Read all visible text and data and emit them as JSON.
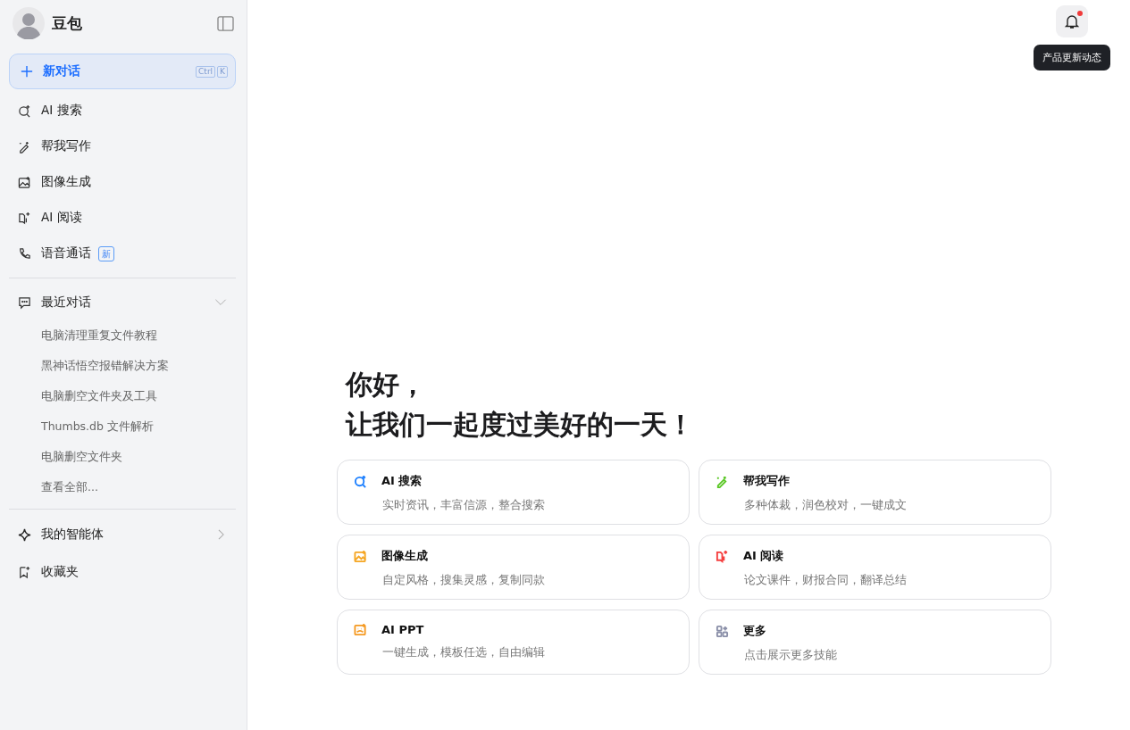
{
  "app": {
    "name": "豆包"
  },
  "new_chat": {
    "label": "新对话",
    "keys": [
      "Ctrl",
      "K"
    ]
  },
  "nav": [
    {
      "label": "AI 搜索",
      "kind": "search"
    },
    {
      "label": "帮我写作",
      "kind": "write"
    },
    {
      "label": "图像生成",
      "kind": "image"
    },
    {
      "label": "AI 阅读",
      "kind": "read"
    },
    {
      "label": "语音通话",
      "kind": "phone",
      "badge": "新"
    }
  ],
  "recent": {
    "label": "最近对话",
    "expanded": true,
    "items": [
      "电脑清理重复文件教程",
      "黑神话悟空报错解决方案",
      "电脑删空文件夹及工具",
      "Thumbs.db 文件解析",
      "电脑删空文件夹"
    ],
    "view_all": "查看全部..."
  },
  "agents": {
    "label": "我的智能体"
  },
  "favorites": {
    "label": "收藏夹"
  },
  "notifications": {
    "unread": true,
    "tooltip": "产品更新动态"
  },
  "greeting": [
    "你好，",
    "让我们一起度过美好的一天！"
  ],
  "skills": [
    {
      "title": "AI 搜索",
      "desc": "实时资讯，丰富信源，整合搜索",
      "kind": "search",
      "color": "#1e80ff"
    },
    {
      "title": "帮我写作",
      "desc": "多种体裁，润色校对，一键成文",
      "kind": "write",
      "color": "#5ac725"
    },
    {
      "title": "图像生成",
      "desc": "自定风格，搜集灵感，复制同款",
      "kind": "image",
      "color": "#f5a623"
    },
    {
      "title": "AI 阅读",
      "desc": "论文课件，财报合同，翻译总结",
      "kind": "read",
      "color": "#f53f3f"
    },
    {
      "title": "AI PPT",
      "desc": "一键生成，模板任选，自由编辑",
      "kind": "ppt",
      "color": "#f59a23"
    },
    {
      "title": "更多",
      "desc": "点击展示更多技能",
      "kind": "more",
      "color": "#8a8fa8"
    }
  ]
}
